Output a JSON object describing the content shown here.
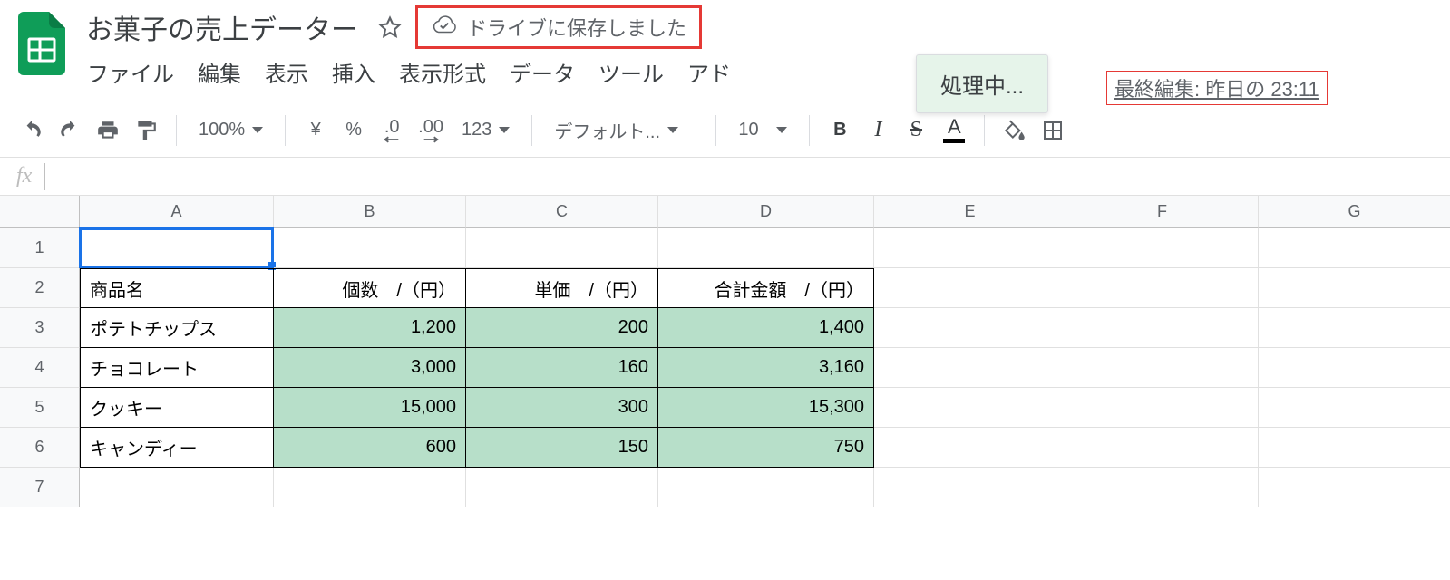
{
  "header": {
    "doc_title": "お菓子の売上データー",
    "save_status": "ドライブに保存しました",
    "working": "処理中...",
    "last_edit": "最終編集: 昨日の 23:11"
  },
  "menubar": {
    "file": "ファイル",
    "edit": "編集",
    "view": "表示",
    "insert": "挿入",
    "format": "表示形式",
    "data": "データ",
    "tools": "ツール",
    "addons": "アド"
  },
  "toolbar": {
    "zoom": "100%",
    "currency": "¥",
    "percent": "%",
    "dec_dec": ".0",
    "inc_dec": ".00",
    "numfmt": "123",
    "font": "デフォルト...",
    "fontsize": "10",
    "bold": "B",
    "italic": "I",
    "strike": "S",
    "textcolor": "A"
  },
  "columns": [
    "A",
    "B",
    "C",
    "D",
    "E",
    "F",
    "G"
  ],
  "row_numbers": [
    "1",
    "2",
    "3",
    "4",
    "5",
    "6",
    "7"
  ],
  "sheet": {
    "headers": {
      "A": "商品名",
      "B": "個数　/（円）",
      "C": "単価　/（円）",
      "D": "合計金額　/（円）"
    },
    "rows": [
      {
        "A": "ポテトチップス",
        "B": "1,200",
        "C": "200",
        "D": "1,400"
      },
      {
        "A": "チョコレート",
        "B": "3,000",
        "C": "160",
        "D": "3,160"
      },
      {
        "A": "クッキー",
        "B": "15,000",
        "C": "300",
        "D": "15,300"
      },
      {
        "A": "キャンディー",
        "B": "600",
        "C": "150",
        "D": "750"
      }
    ]
  },
  "active_cell": "A1",
  "formula_bar_value": ""
}
